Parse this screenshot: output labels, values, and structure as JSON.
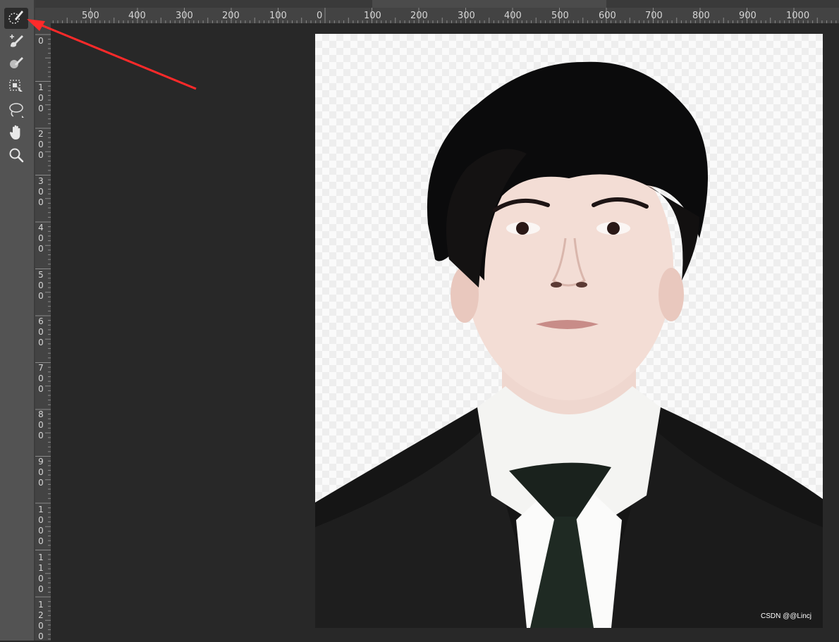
{
  "toolbar": {
    "tools": [
      {
        "name": "quick-selection-brush-icon",
        "active": true
      },
      {
        "name": "brush-plus-icon",
        "active": false
      },
      {
        "name": "brush-minus-icon",
        "active": false
      },
      {
        "name": "object-selection-icon",
        "active": false
      },
      {
        "name": "lasso-icon",
        "active": false
      },
      {
        "name": "hand-icon",
        "active": false
      },
      {
        "name": "zoom-icon",
        "active": false
      }
    ]
  },
  "ruler": {
    "top": [
      "500",
      "400",
      "300",
      "200",
      "100",
      "0",
      "100",
      "200",
      "300",
      "400",
      "500",
      "600",
      "700",
      "800",
      "900",
      "1000"
    ],
    "left": [
      "0",
      "100",
      "200",
      "300",
      "400",
      "500",
      "600",
      "700",
      "800",
      "900",
      "1000",
      "1100",
      "1200"
    ]
  },
  "watermark": "CSDN @@Lincj",
  "colors": {
    "ui_dark": "#282828",
    "toolbar": "#535353",
    "ruler": "#434343",
    "annotation_arrow": "#ff2a2a"
  }
}
